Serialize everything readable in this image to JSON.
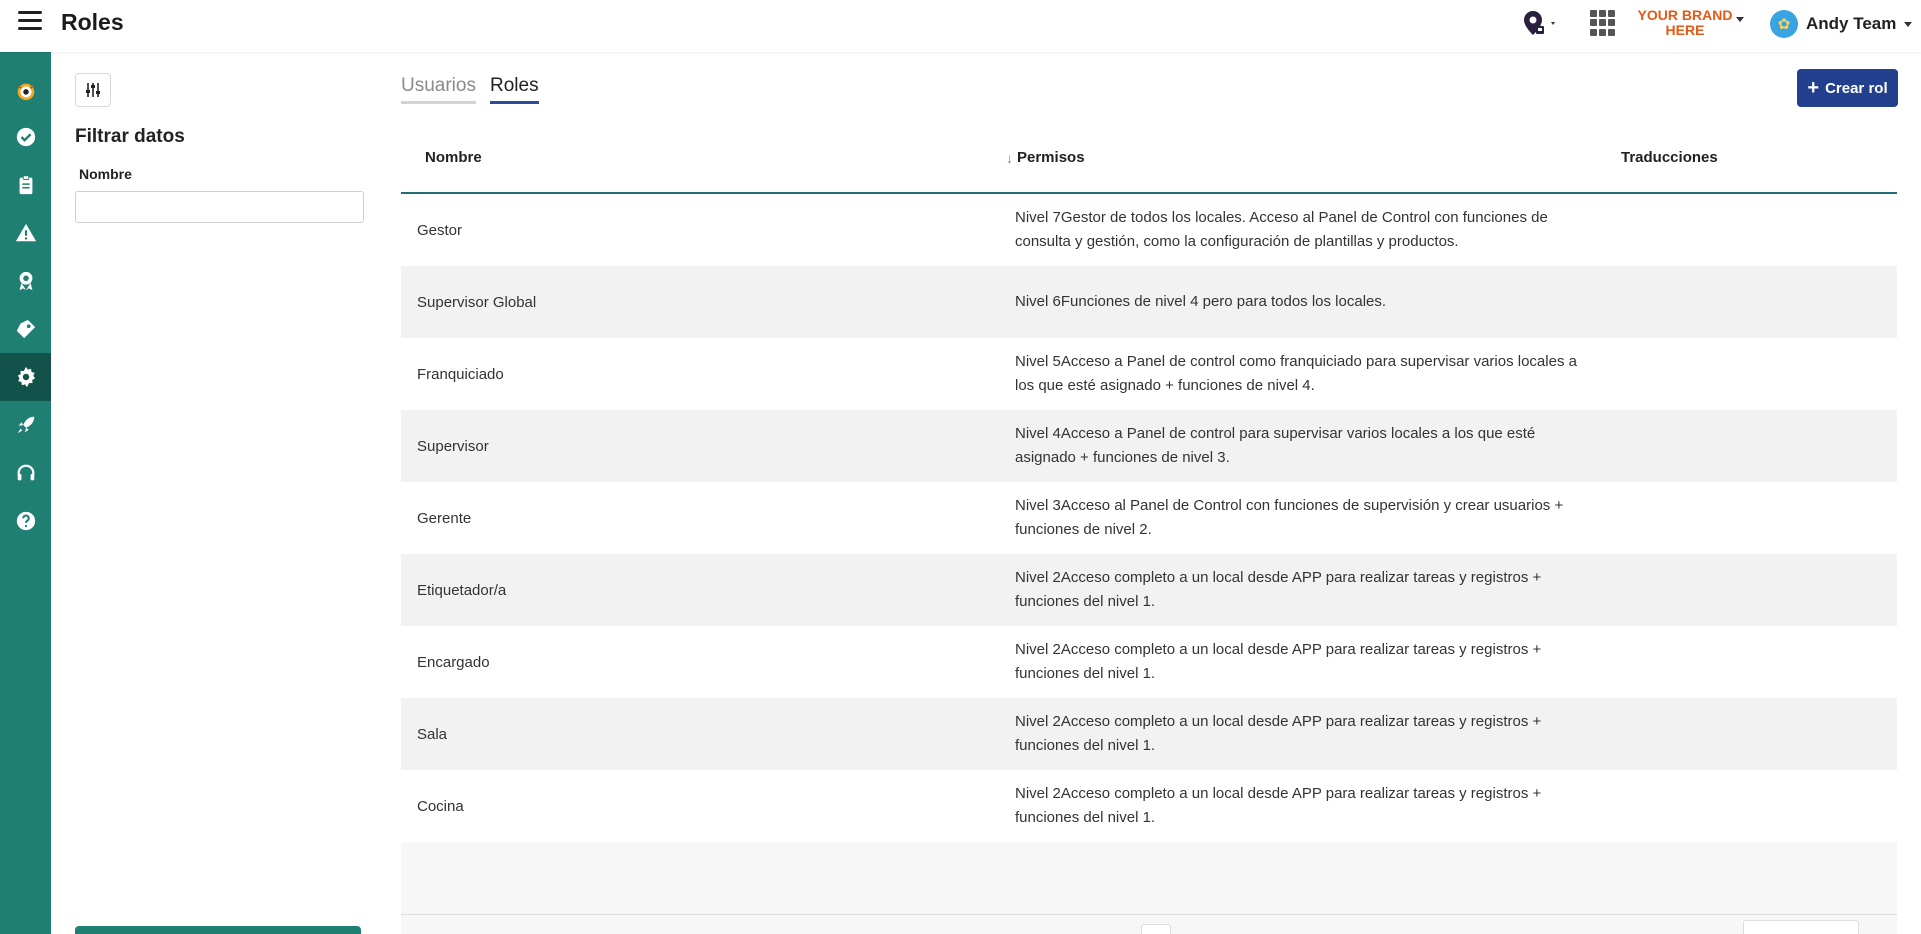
{
  "header": {
    "title": "Roles",
    "brand_line1": "YOUR BRAND",
    "brand_line2": "HERE",
    "user_name": "Andy Team",
    "brand_color": "#e25a16"
  },
  "sidebar": {
    "color": "#1f7f73",
    "active_color": "#13524b",
    "items": [
      {
        "icon": "owl-logo-icon"
      },
      {
        "icon": "check-circle-icon"
      },
      {
        "icon": "clipboard-icon"
      },
      {
        "icon": "warning-icon"
      },
      {
        "icon": "award-icon"
      },
      {
        "icon": "tag-icon"
      },
      {
        "icon": "gear-icon",
        "active": true
      },
      {
        "icon": "rocket-icon"
      },
      {
        "icon": "headset-icon"
      },
      {
        "icon": "help-icon"
      }
    ]
  },
  "filter": {
    "title": "Filtrar datos",
    "name_label": "Nombre",
    "name_value": ""
  },
  "tabs": [
    {
      "label": "Usuarios",
      "active": false
    },
    {
      "label": "Roles",
      "active": true
    }
  ],
  "create_button": {
    "label": "Crear rol",
    "color": "#23408e"
  },
  "table": {
    "columns": [
      "Nombre",
      "Permisos",
      "Traducciones"
    ],
    "rows": [
      {
        "name": "Gestor",
        "permisos": "Nivel 7Gestor de todos los locales. Acceso al Panel de Control con funciones de consulta y gestión, como la configuración de plantillas y productos.",
        "traducciones": ""
      },
      {
        "name": "Supervisor Global",
        "permisos": "Nivel 6Funciones de nivel 4 pero para todos los locales.",
        "traducciones": ""
      },
      {
        "name": "Franquiciado",
        "permisos": "Nivel 5Acceso a Panel de control como franquiciado para supervisar varios locales a los que esté asignado + funciones de nivel 4.",
        "traducciones": ""
      },
      {
        "name": "Supervisor",
        "permisos": "Nivel 4Acceso a Panel de control para supervisar varios locales a los que esté asignado + funciones de nivel 3.",
        "traducciones": ""
      },
      {
        "name": "Gerente",
        "permisos": "Nivel 3Acceso al Panel de Control con funciones de supervisión y crear usuarios + funciones de nivel 2.",
        "traducciones": ""
      },
      {
        "name": "Etiquetador/a",
        "permisos": "Nivel 2Acceso completo a un local desde APP para realizar tareas y registros + funciones del nivel 1.",
        "traducciones": ""
      },
      {
        "name": "Encargado",
        "permisos": "Nivel 2Acceso completo a un local desde APP para realizar tareas y registros + funciones del nivel 1.",
        "traducciones": ""
      },
      {
        "name": "Sala",
        "permisos": "Nivel 2Acceso completo a un local desde APP para realizar tareas y registros + funciones del nivel 1.",
        "traducciones": ""
      },
      {
        "name": "Cocina",
        "permisos": "Nivel 2Acceso completo a un local desde APP para realizar tareas y registros + funciones del nivel 1.",
        "traducciones": ""
      }
    ]
  }
}
